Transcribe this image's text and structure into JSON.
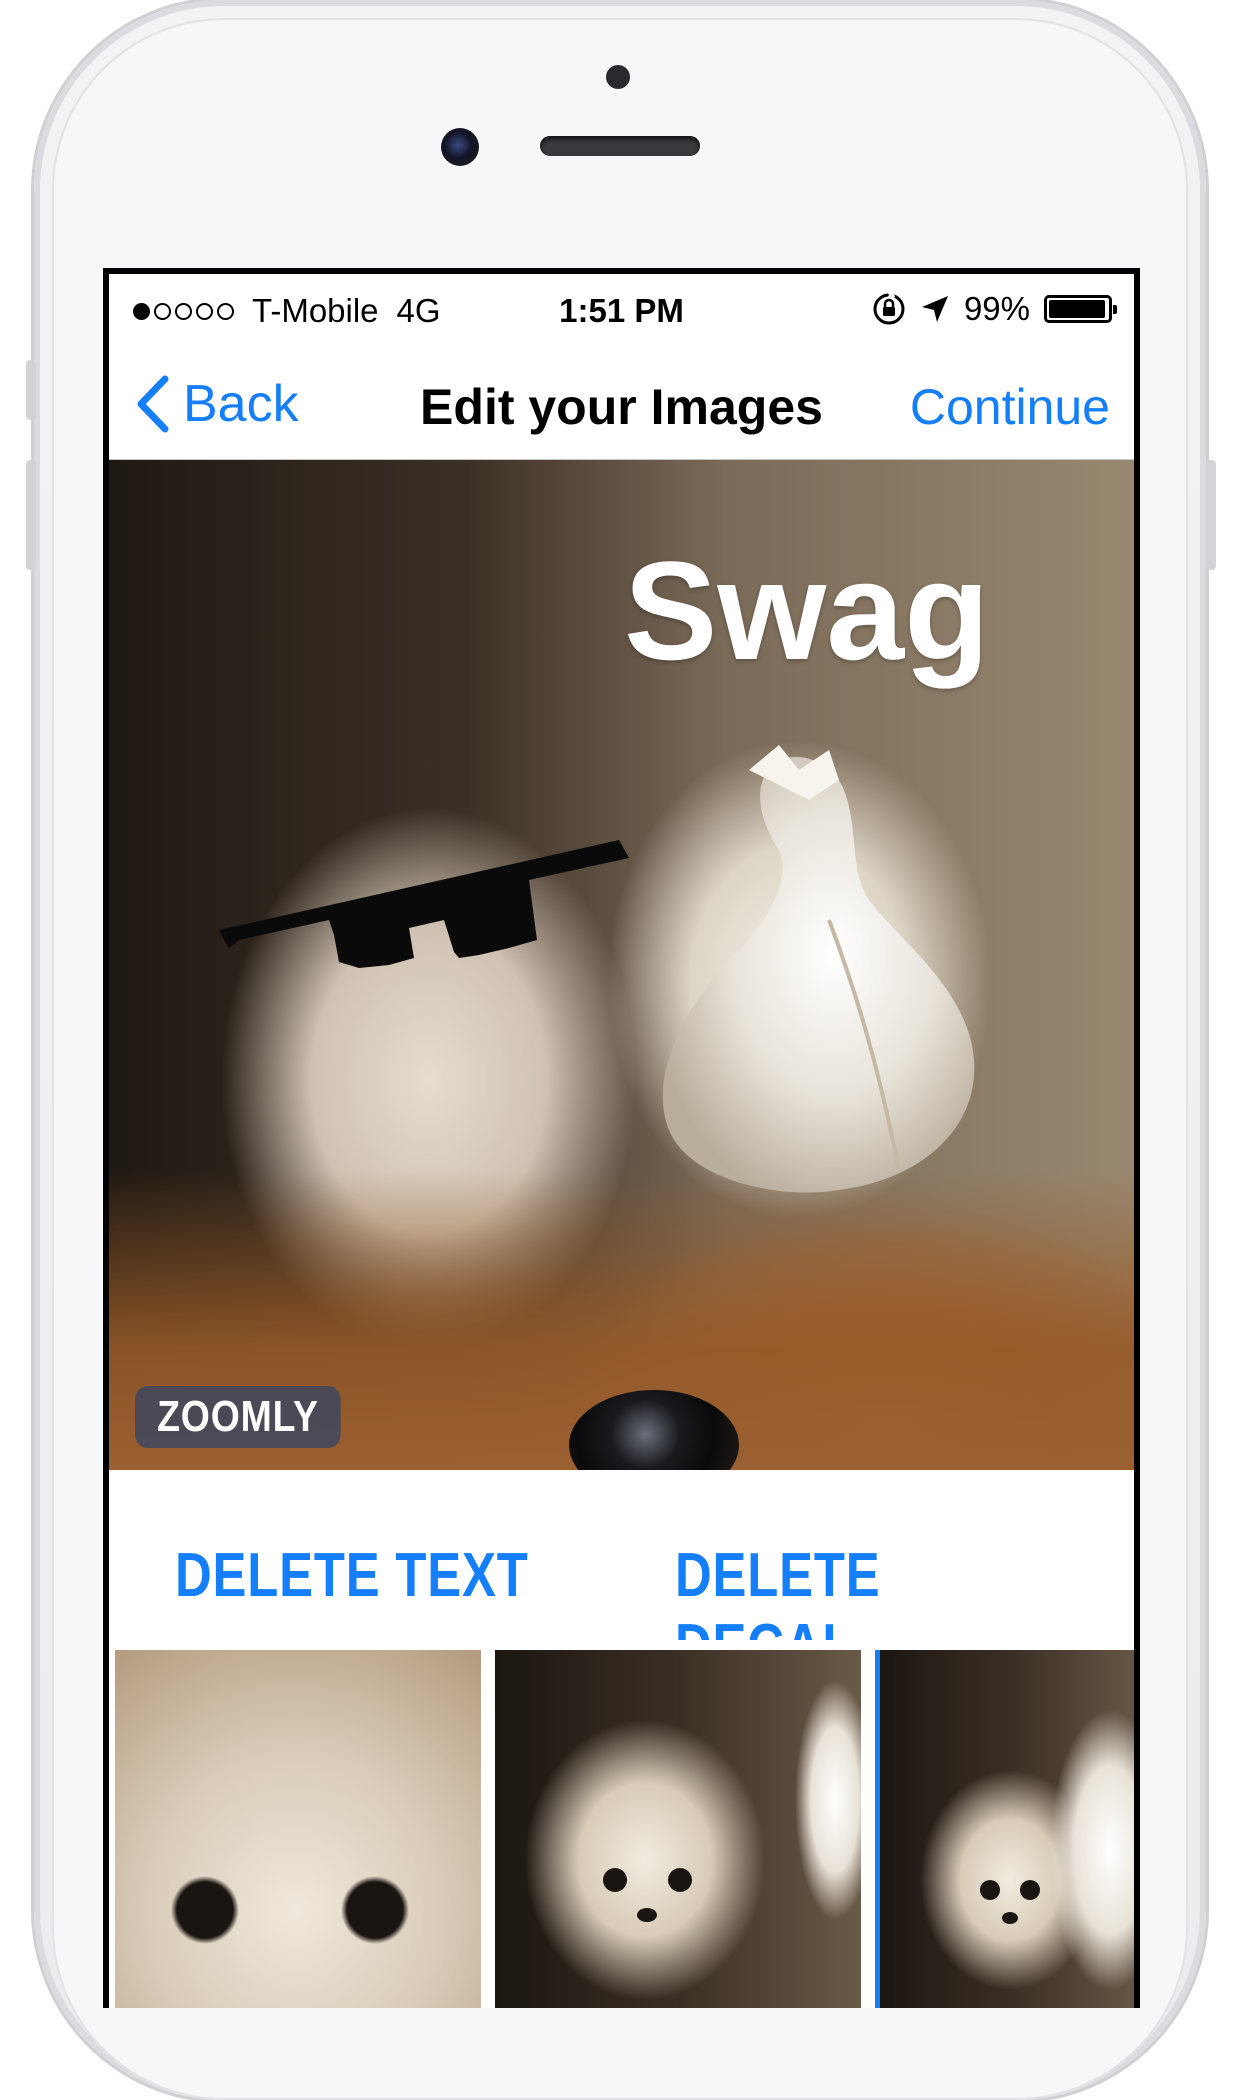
{
  "status_bar": {
    "carrier": "T-Mobile",
    "network": "4G",
    "time": "1:51 PM",
    "battery": "99%",
    "battery_level": 0.99,
    "signal_bars_filled": 1,
    "signal_bars_total": 5
  },
  "nav": {
    "back_label": "Back",
    "title": "Edit your Images",
    "continue_label": "Continue",
    "accent_color": "#147efb"
  },
  "editor": {
    "overlay_text": "Swag",
    "watermark": "ZOOMLY"
  },
  "actions": {
    "delete_text": "DELETE TEXT",
    "delete_decal": "DELETE DECAL"
  },
  "thumbnails": [
    {
      "name": "thumbnail-1",
      "selected": false
    },
    {
      "name": "thumbnail-2",
      "selected": false
    },
    {
      "name": "thumbnail-3",
      "selected": true
    }
  ]
}
